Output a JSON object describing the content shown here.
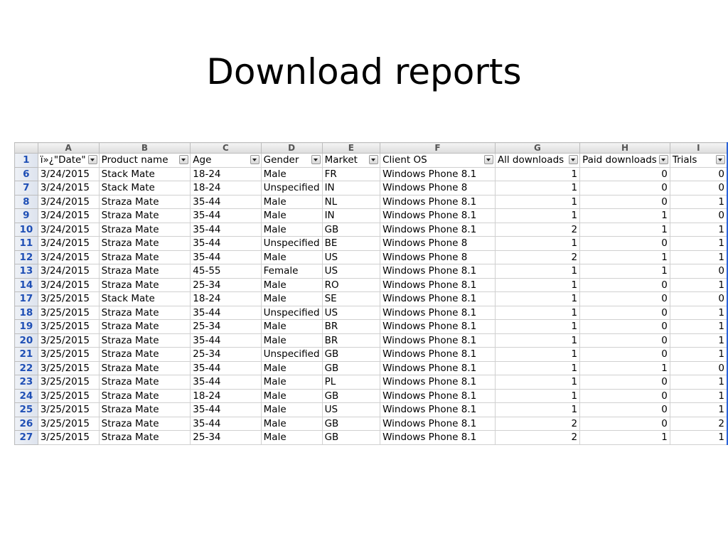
{
  "slide": {
    "title": "Download reports"
  },
  "spreadsheet": {
    "column_letters": [
      "A",
      "B",
      "C",
      "D",
      "E",
      "F",
      "G",
      "H",
      "I"
    ],
    "header_row_number": "1",
    "headers": [
      "ï»¿\"Date\"",
      "Product name",
      "Age",
      "Gender",
      "Market",
      "Client OS",
      "All downloads",
      "Paid downloads",
      "Trials"
    ],
    "filtered_column": "Product name",
    "accent_color": "#1f4fb5",
    "rows": [
      {
        "row": "6",
        "cells": [
          "3/24/2015",
          "Stack Mate",
          "18-24",
          "Male",
          "FR",
          "Windows Phone 8.1",
          "1",
          "0",
          "0"
        ]
      },
      {
        "row": "7",
        "cells": [
          "3/24/2015",
          "Stack Mate",
          "18-24",
          "Unspecified",
          "IN",
          "Windows Phone 8",
          "1",
          "0",
          "0"
        ]
      },
      {
        "row": "8",
        "cells": [
          "3/24/2015",
          "Straza Mate",
          "35-44",
          "Male",
          "NL",
          "Windows Phone 8.1",
          "1",
          "0",
          "1"
        ]
      },
      {
        "row": "9",
        "cells": [
          "3/24/2015",
          "Straza Mate",
          "35-44",
          "Male",
          "IN",
          "Windows Phone 8.1",
          "1",
          "1",
          "0"
        ]
      },
      {
        "row": "10",
        "cells": [
          "3/24/2015",
          "Straza Mate",
          "35-44",
          "Male",
          "GB",
          "Windows Phone 8.1",
          "2",
          "1",
          "1"
        ]
      },
      {
        "row": "11",
        "cells": [
          "3/24/2015",
          "Straza Mate",
          "35-44",
          "Unspecified",
          "BE",
          "Windows Phone 8",
          "1",
          "0",
          "1"
        ]
      },
      {
        "row": "12",
        "cells": [
          "3/24/2015",
          "Straza Mate",
          "35-44",
          "Male",
          "US",
          "Windows Phone 8",
          "2",
          "1",
          "1"
        ]
      },
      {
        "row": "13",
        "cells": [
          "3/24/2015",
          "Straza Mate",
          "45-55",
          "Female",
          "US",
          "Windows Phone 8.1",
          "1",
          "1",
          "0"
        ]
      },
      {
        "row": "14",
        "cells": [
          "3/24/2015",
          "Straza Mate",
          "25-34",
          "Male",
          "RO",
          "Windows Phone 8.1",
          "1",
          "0",
          "1"
        ]
      },
      {
        "row": "17",
        "cells": [
          "3/25/2015",
          "Stack Mate",
          "18-24",
          "Male",
          "SE",
          "Windows Phone 8.1",
          "1",
          "0",
          "0"
        ]
      },
      {
        "row": "18",
        "cells": [
          "3/25/2015",
          "Straza Mate",
          "35-44",
          "Unspecified",
          "US",
          "Windows Phone 8.1",
          "1",
          "0",
          "1"
        ]
      },
      {
        "row": "19",
        "cells": [
          "3/25/2015",
          "Straza Mate",
          "25-34",
          "Male",
          "BR",
          "Windows Phone 8.1",
          "1",
          "0",
          "1"
        ]
      },
      {
        "row": "20",
        "cells": [
          "3/25/2015",
          "Straza Mate",
          "35-44",
          "Male",
          "BR",
          "Windows Phone 8.1",
          "1",
          "0",
          "1"
        ]
      },
      {
        "row": "21",
        "cells": [
          "3/25/2015",
          "Straza Mate",
          "25-34",
          "Unspecified",
          "GB",
          "Windows Phone 8.1",
          "1",
          "0",
          "1"
        ]
      },
      {
        "row": "22",
        "cells": [
          "3/25/2015",
          "Straza Mate",
          "35-44",
          "Male",
          "GB",
          "Windows Phone 8.1",
          "1",
          "1",
          "0"
        ]
      },
      {
        "row": "23",
        "cells": [
          "3/25/2015",
          "Straza Mate",
          "35-44",
          "Male",
          "PL",
          "Windows Phone 8.1",
          "1",
          "0",
          "1"
        ]
      },
      {
        "row": "24",
        "cells": [
          "3/25/2015",
          "Straza Mate",
          "18-24",
          "Male",
          "GB",
          "Windows Phone 8.1",
          "1",
          "0",
          "1"
        ]
      },
      {
        "row": "25",
        "cells": [
          "3/25/2015",
          "Straza Mate",
          "35-44",
          "Male",
          "US",
          "Windows Phone 8.1",
          "1",
          "0",
          "1"
        ]
      },
      {
        "row": "26",
        "cells": [
          "3/25/2015",
          "Straza Mate",
          "35-44",
          "Male",
          "GB",
          "Windows Phone 8.1",
          "2",
          "0",
          "2"
        ]
      },
      {
        "row": "27",
        "cells": [
          "3/25/2015",
          "Straza Mate",
          "25-34",
          "Male",
          "GB",
          "Windows Phone 8.1",
          "2",
          "1",
          "1"
        ]
      }
    ]
  }
}
